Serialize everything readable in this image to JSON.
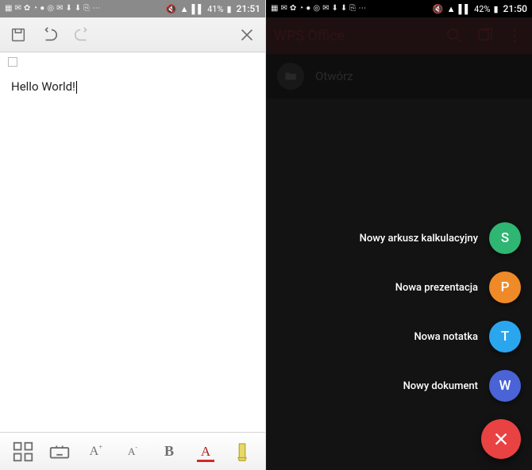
{
  "left": {
    "status": {
      "battery": "41%",
      "time": "21:51"
    },
    "document_text": "Hello World!",
    "bottom": {
      "a_increase": "A",
      "a_increase_sup": "+",
      "a_decrease": "A",
      "a_decrease_sup": "-",
      "bold": "B",
      "font_color": "A"
    }
  },
  "right": {
    "status": {
      "battery": "42%",
      "time": "21:50"
    },
    "app_title": "WPS Office",
    "open_label": "Otwórz",
    "fab": {
      "items": [
        {
          "label": "Nowy arkusz kalkulacyjny",
          "letter": "S",
          "color": "#2fb673"
        },
        {
          "label": "Nowa prezentacja",
          "letter": "P",
          "color": "#ef8a28"
        },
        {
          "label": "Nowa notatka",
          "letter": "T",
          "color": "#2aa6ef"
        },
        {
          "label": "Nowy dokument",
          "letter": "W",
          "color": "#4a63d6"
        }
      ]
    }
  }
}
